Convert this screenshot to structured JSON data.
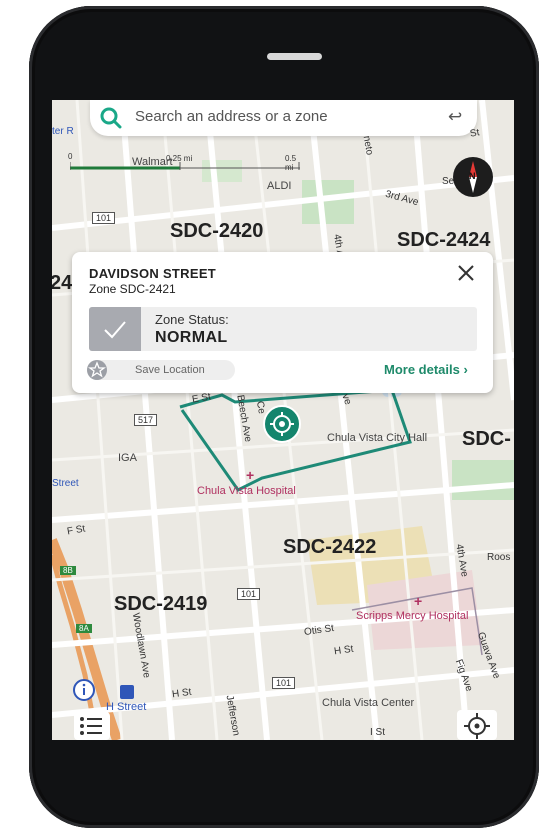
{
  "search": {
    "placeholder": "Search an address or a zone"
  },
  "scale": {
    "zero": "0",
    "mid": "0.25 mi",
    "end": "0.5 mi"
  },
  "compass": {
    "label": "N"
  },
  "zones": [
    "SDC-2420",
    "SDC-2424",
    "SDC-2422",
    "SDC-2419",
    "SDC-",
    "24"
  ],
  "pois": {
    "aldi": "ALDI",
    "walmart": "Walmart",
    "iga": "IGA",
    "city_hall": "Chula Vista City Hall",
    "hospital": "Chula Vista Hospital",
    "scripps": "Scripps Mercy Hospital",
    "center": "Chula Vista Center",
    "h_street_station": "H Street"
  },
  "streets": {
    "third_ave": "3rd Ave",
    "fourth_ave_top": "4th A",
    "fourth_ave_bottom": "4th Ave",
    "beech_ave": "Beech Ave",
    "e_st": "E St",
    "f_st": "F St",
    "street": "Street",
    "woodlawn": "Woodlawn Ave",
    "otis": "Otis St",
    "h_st_mid": "H St",
    "h_st_left": "H St",
    "fig": "Fig Ave",
    "guava": "Guava Ave",
    "jefferson": "Jefferson",
    "roos": "Roos",
    "se": "Se",
    "neto": "neto",
    "i_st": "I St",
    "ce": "Ce",
    "ter_r": "ter R",
    "route_101a": "101",
    "route_517": "517",
    "route_101b": "101",
    "route_101c": "101",
    "exit_8b": "8B",
    "exit_8a": "8A",
    "st_top": "St",
    "ave_e": "ve"
  },
  "card": {
    "title": "DAVIDSON STREET",
    "subtitle": "Zone SDC-2421",
    "status_label": "Zone Status:",
    "status_value": "NORMAL",
    "save_label": "Save Location",
    "more_label": "More details ›"
  },
  "colors": {
    "accent": "#14856d",
    "zone_outline": "#1e8a77",
    "brand_link": "#1e8a6a"
  }
}
